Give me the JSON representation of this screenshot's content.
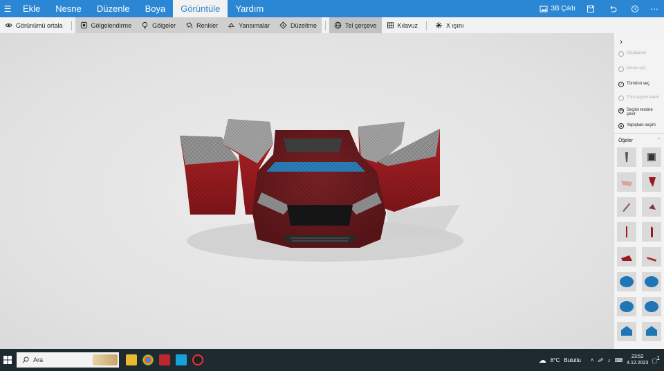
{
  "menubar": {
    "tabs": [
      "Ekle",
      "Nesne",
      "Düzenle",
      "Boya",
      "Görüntüle",
      "Yardım"
    ],
    "active_tab": "Görüntüle",
    "right": {
      "gallery_label": "3B Çıktı"
    }
  },
  "toolbar": {
    "center_view": "Görünümü ortala",
    "shading": "Gölgelendirme",
    "shadows": "Gölgeler",
    "colors": "Renkler",
    "reflections": "Yansımalar",
    "correction": "Düzeltme",
    "wireframe": "Tel çerçeve",
    "guide": "Kılavuz",
    "xray": "X ışını"
  },
  "panel": {
    "items": [
      {
        "label": "Gruplandır",
        "enabled": false
      },
      {
        "label": "Grubu çöz",
        "enabled": false
      },
      {
        "label": "Tümünü seç",
        "enabled": true
      },
      {
        "label": "Tüm seçimi kaldır",
        "enabled": false
      },
      {
        "label": "Seçimi tersine çevir",
        "enabled": true
      },
      {
        "label": "Yapışkan seçim",
        "enabled": true
      }
    ],
    "section_title": "Öğeler"
  },
  "taskbar": {
    "search_placeholder": "Ara",
    "weather": "8°C",
    "weather_text": "Bulutlu",
    "time": "23:52",
    "date": "4.12.2023",
    "notification_count": "1"
  },
  "colors": {
    "accent": "#2b87d3",
    "car_red": "#9a1b1f",
    "taskbar": "#1e2a2f"
  }
}
